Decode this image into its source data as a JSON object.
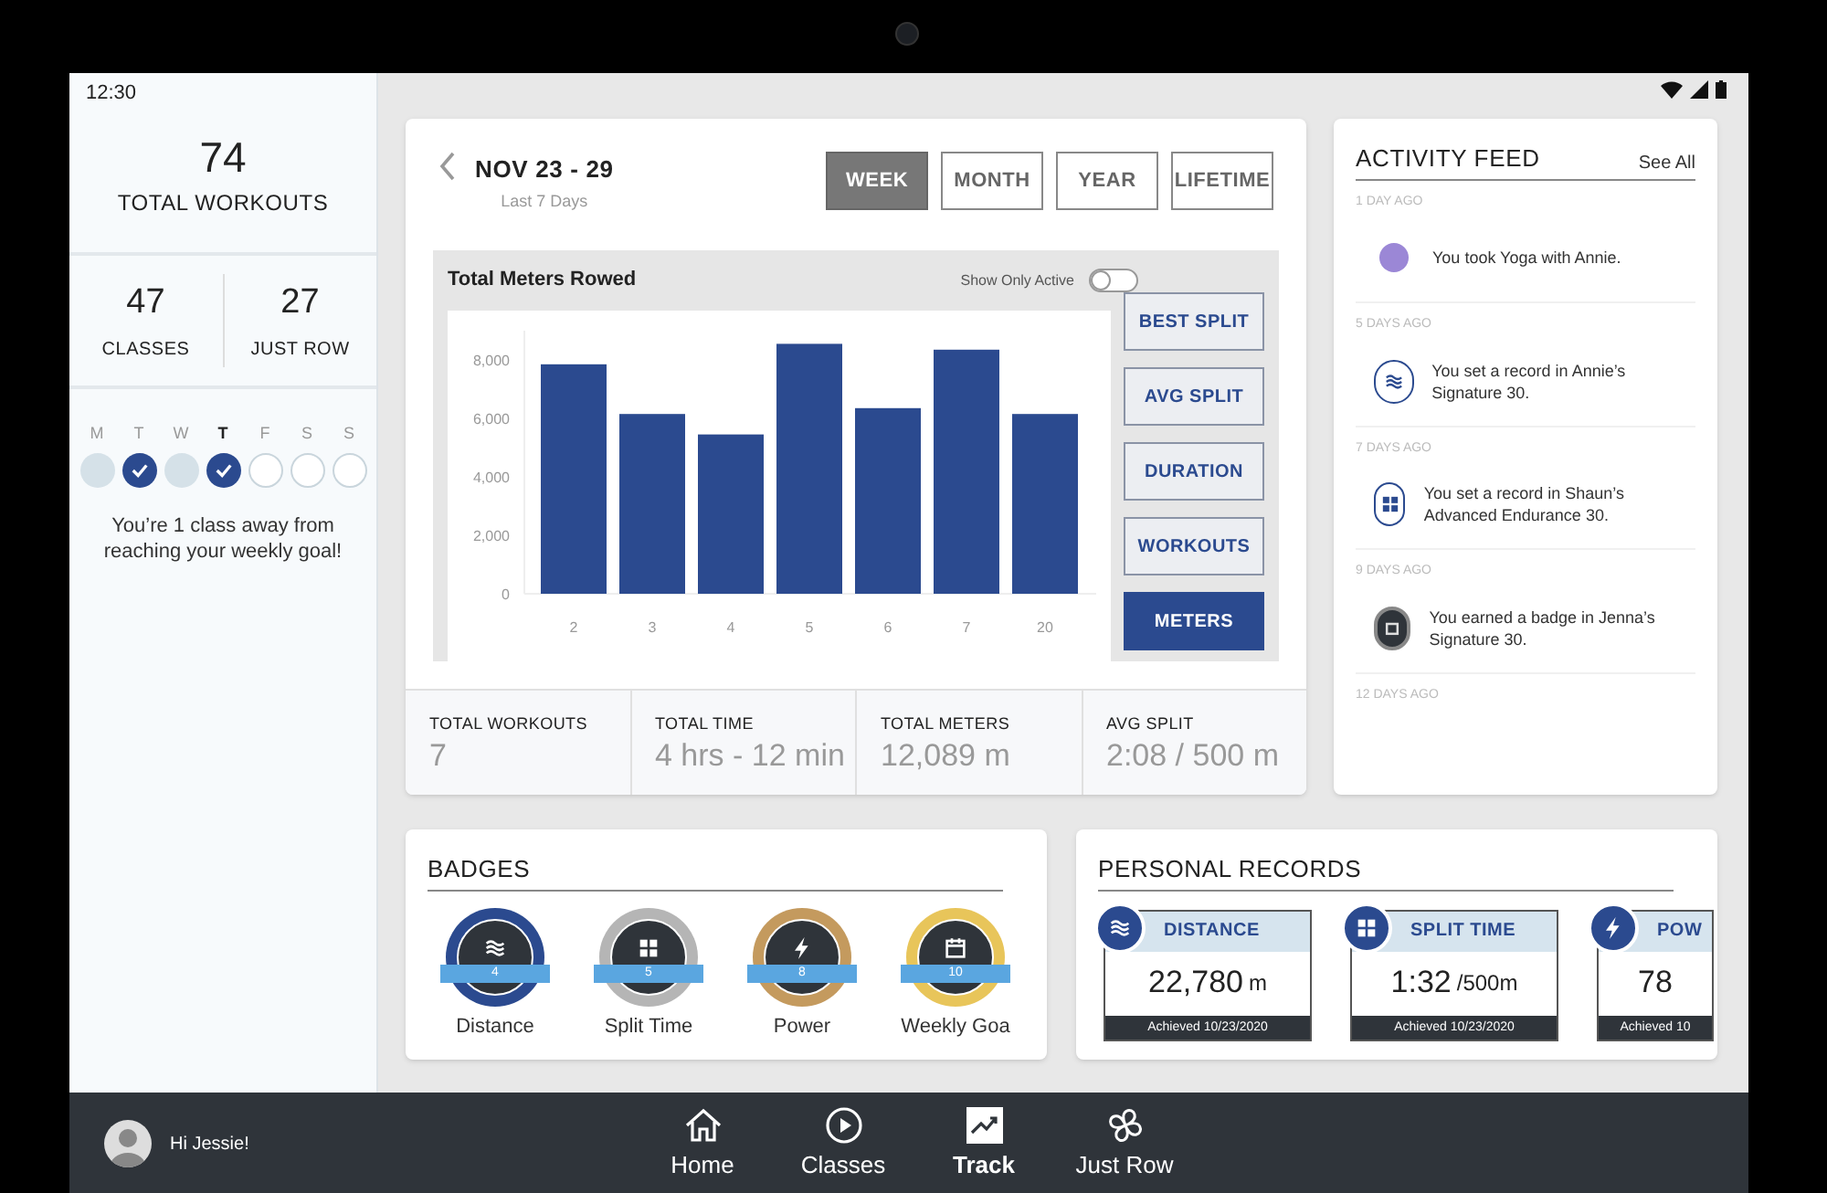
{
  "status_bar": {
    "time": "12:30"
  },
  "summary": {
    "total_value": "74",
    "total_label": "TOTAL WORKOUTS",
    "stats": [
      {
        "value": "47",
        "label": "CLASSES"
      },
      {
        "value": "27",
        "label": "JUST ROW"
      }
    ],
    "week": [
      {
        "letter": "M",
        "kind": "missed",
        "today": false
      },
      {
        "letter": "T",
        "kind": "done",
        "today": false
      },
      {
        "letter": "W",
        "kind": "missed",
        "today": false
      },
      {
        "letter": "T",
        "kind": "done",
        "today": true
      },
      {
        "letter": "F",
        "kind": "upcoming",
        "today": false
      },
      {
        "letter": "S",
        "kind": "upcoming",
        "today": false
      },
      {
        "letter": "S",
        "kind": "upcoming",
        "today": false
      }
    ],
    "message": "You’re 1 class away from reaching your weekly goal!"
  },
  "date_range": {
    "title": "NOV 23 - 29",
    "subtitle": "Last 7 Days"
  },
  "period_tabs": [
    {
      "label": "WEEK",
      "selected": true
    },
    {
      "label": "MONTH",
      "selected": false
    },
    {
      "label": "YEAR",
      "selected": false
    },
    {
      "label": "LIFETIME",
      "selected": false
    }
  ],
  "chart_panel": {
    "title": "Total Meters Rowed",
    "toggle": {
      "label": "Show Only Active",
      "on": false
    },
    "chart_data": {
      "type": "bar",
      "categories": [
        "2",
        "3",
        "4",
        "5",
        "6",
        "7",
        "20"
      ],
      "series": [
        {
          "color": "#2b4a8f",
          "values": [
            7850,
            6150,
            5450,
            8550,
            6350,
            8350,
            6150
          ]
        }
      ],
      "ylim": [
        0,
        9000
      ],
      "yticks": [
        {
          "value": 0,
          "label": "0"
        },
        {
          "value": 2000,
          "label": "2,000"
        },
        {
          "value": 4000,
          "label": "4,000"
        },
        {
          "value": 6000,
          "label": "6,000"
        },
        {
          "value": 8000,
          "label": "8,000"
        }
      ]
    },
    "metric_buttons": [
      {
        "label": "BEST SPLIT",
        "selected": false
      },
      {
        "label": "AVG SPLIT",
        "selected": false
      },
      {
        "label": "DURATION",
        "selected": false
      },
      {
        "label": "WORKOUTS",
        "selected": false
      },
      {
        "label": "METERS",
        "selected": true
      }
    ]
  },
  "totals": [
    {
      "label": "TOTAL WORKOUTS",
      "value": "7"
    },
    {
      "label": "TOTAL TIME",
      "value": "4 hrs - 12 min"
    },
    {
      "label": "TOTAL METERS",
      "value": "12,089 m"
    },
    {
      "label": "AVG SPLIT",
      "value": "2:08 / 500 m"
    }
  ],
  "activity_feed": {
    "title": "ACTIVITY FEED",
    "see_all": "See All",
    "items": [
      {
        "time": "1 DAY AGO",
        "text": "You took Yoga with Annie.",
        "kind": "dot",
        "color": "#9b87d6"
      },
      {
        "time": "5 DAYS AGO",
        "text": "You set a record in Annie’s Signature 30.",
        "kind": "waves"
      },
      {
        "time": "7 DAYS AGO",
        "text": "You set a record in Shaun’s Advanced Endurance 30.",
        "kind": "grid"
      },
      {
        "time": "9 DAYS AGO",
        "text": "You earned a badge in Jenna’s Signature 30.",
        "kind": "badge"
      },
      {
        "time": "12 DAYS AGO"
      }
    ]
  },
  "badges": {
    "title": "BADGES",
    "items": [
      {
        "name": "Distance",
        "count": "4",
        "kind": "waves",
        "color": "#2b4a8f"
      },
      {
        "name": "Split Time",
        "count": "5",
        "kind": "grid",
        "color": "#b5b5b5"
      },
      {
        "name": "Power",
        "count": "8",
        "kind": "bolt",
        "color": "#c49a5e"
      },
      {
        "name": "Weekly Goa",
        "count": "10",
        "kind": "calendar",
        "color": "#e8c55a"
      }
    ]
  },
  "personal_records": {
    "title": "PERSONAL RECORDS",
    "items": [
      {
        "title": "DISTANCE",
        "kind": "waves",
        "value": "22,780",
        "unit": "m",
        "date": "Achieved 10/23/2020"
      },
      {
        "title": "SPLIT TIME",
        "kind": "grid",
        "value": "1:32",
        "unit": "/500m",
        "date": "Achieved 10/23/2020"
      },
      {
        "title": "POW",
        "kind": "bolt",
        "value": "78",
        "date": "Achieved 10"
      }
    ]
  },
  "nav": {
    "greeting": "Hi Jessie!",
    "items": [
      {
        "label": "Home",
        "kind": "home",
        "selected": false
      },
      {
        "label": "Classes",
        "kind": "play",
        "selected": false
      },
      {
        "label": "Track",
        "kind": "trend",
        "selected": true
      },
      {
        "label": "Just Row",
        "kind": "fan",
        "selected": false
      }
    ]
  }
}
